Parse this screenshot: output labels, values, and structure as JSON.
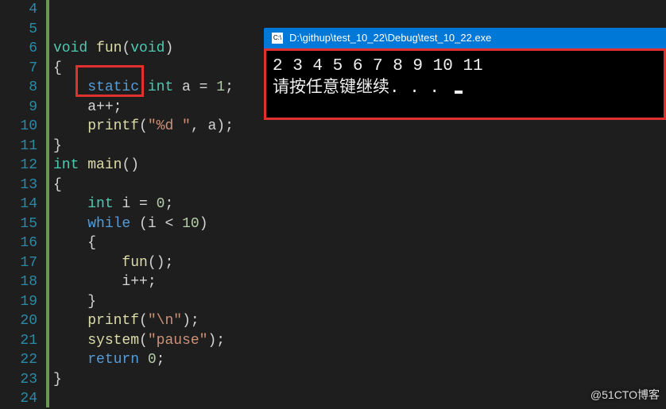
{
  "editor": {
    "lines": [
      {
        "n": 4,
        "tokens": []
      },
      {
        "n": 5,
        "tokens": []
      },
      {
        "n": 6,
        "collapse": true,
        "tokens": [
          {
            "t": "void",
            "c": "tok-type"
          },
          {
            "t": " ",
            "c": ""
          },
          {
            "t": "fun",
            "c": "tok-func"
          },
          {
            "t": "(",
            "c": "tok-punct"
          },
          {
            "t": "void",
            "c": "tok-type"
          },
          {
            "t": ")",
            "c": "tok-punct"
          }
        ]
      },
      {
        "n": 7,
        "tokens": [
          {
            "t": "{",
            "c": "tok-brace"
          }
        ]
      },
      {
        "n": 8,
        "tokens": [
          {
            "t": "    ",
            "c": ""
          },
          {
            "t": "static",
            "c": "tok-keyword"
          },
          {
            "t": " ",
            "c": ""
          },
          {
            "t": "int",
            "c": "tok-type"
          },
          {
            "t": " a ",
            "c": "tok-var"
          },
          {
            "t": "=",
            "c": "tok-op"
          },
          {
            "t": " ",
            "c": ""
          },
          {
            "t": "1",
            "c": "tok-number"
          },
          {
            "t": ";",
            "c": "tok-punct"
          }
        ]
      },
      {
        "n": 9,
        "tokens": [
          {
            "t": "    a",
            "c": "tok-var"
          },
          {
            "t": "++",
            "c": "tok-op"
          },
          {
            "t": ";",
            "c": "tok-punct"
          }
        ]
      },
      {
        "n": 10,
        "tokens": [
          {
            "t": "    ",
            "c": ""
          },
          {
            "t": "printf",
            "c": "tok-func"
          },
          {
            "t": "(",
            "c": "tok-punct"
          },
          {
            "t": "\"%d \"",
            "c": "tok-string"
          },
          {
            "t": ", a",
            "c": "tok-var"
          },
          {
            "t": ")",
            "c": "tok-punct"
          },
          {
            "t": ";",
            "c": "tok-punct"
          }
        ]
      },
      {
        "n": 11,
        "tokens": [
          {
            "t": "}",
            "c": "tok-brace"
          }
        ]
      },
      {
        "n": 12,
        "collapse": true,
        "tokens": [
          {
            "t": "int",
            "c": "tok-type"
          },
          {
            "t": " ",
            "c": ""
          },
          {
            "t": "main",
            "c": "tok-func"
          },
          {
            "t": "()",
            "c": "tok-punct"
          }
        ]
      },
      {
        "n": 13,
        "tokens": [
          {
            "t": "{",
            "c": "tok-brace"
          }
        ]
      },
      {
        "n": 14,
        "tokens": [
          {
            "t": "    ",
            "c": ""
          },
          {
            "t": "int",
            "c": "tok-type"
          },
          {
            "t": " i ",
            "c": "tok-var"
          },
          {
            "t": "=",
            "c": "tok-op"
          },
          {
            "t": " ",
            "c": ""
          },
          {
            "t": "0",
            "c": "tok-number"
          },
          {
            "t": ";",
            "c": "tok-punct"
          }
        ]
      },
      {
        "n": 15,
        "tokens": [
          {
            "t": "    ",
            "c": ""
          },
          {
            "t": "while",
            "c": "tok-keyword"
          },
          {
            "t": " (i ",
            "c": "tok-var"
          },
          {
            "t": "<",
            "c": "tok-op"
          },
          {
            "t": " ",
            "c": ""
          },
          {
            "t": "10",
            "c": "tok-number"
          },
          {
            "t": ")",
            "c": "tok-punct"
          }
        ]
      },
      {
        "n": 16,
        "tokens": [
          {
            "t": "    {",
            "c": "tok-brace"
          }
        ]
      },
      {
        "n": 17,
        "tokens": [
          {
            "t": "        ",
            "c": ""
          },
          {
            "t": "fun",
            "c": "tok-func"
          },
          {
            "t": "()",
            "c": "tok-punct"
          },
          {
            "t": ";",
            "c": "tok-punct"
          }
        ]
      },
      {
        "n": 18,
        "tokens": [
          {
            "t": "        i",
            "c": "tok-var"
          },
          {
            "t": "++",
            "c": "tok-op"
          },
          {
            "t": ";",
            "c": "tok-punct"
          }
        ]
      },
      {
        "n": 19,
        "tokens": [
          {
            "t": "    }",
            "c": "tok-brace"
          }
        ]
      },
      {
        "n": 20,
        "tokens": [
          {
            "t": "    ",
            "c": ""
          },
          {
            "t": "printf",
            "c": "tok-func"
          },
          {
            "t": "(",
            "c": "tok-punct"
          },
          {
            "t": "\"\\n\"",
            "c": "tok-string"
          },
          {
            "t": ")",
            "c": "tok-punct"
          },
          {
            "t": ";",
            "c": "tok-punct"
          }
        ]
      },
      {
        "n": 21,
        "tokens": [
          {
            "t": "    ",
            "c": ""
          },
          {
            "t": "system",
            "c": "tok-func"
          },
          {
            "t": "(",
            "c": "tok-punct"
          },
          {
            "t": "\"pause\"",
            "c": "tok-string"
          },
          {
            "t": ")",
            "c": "tok-punct"
          },
          {
            "t": ";",
            "c": "tok-punct"
          }
        ]
      },
      {
        "n": 22,
        "tokens": [
          {
            "t": "    ",
            "c": ""
          },
          {
            "t": "return",
            "c": "tok-keyword"
          },
          {
            "t": " ",
            "c": ""
          },
          {
            "t": "0",
            "c": "tok-number"
          },
          {
            "t": ";",
            "c": "tok-punct"
          }
        ]
      },
      {
        "n": 23,
        "tokens": [
          {
            "t": "}",
            "c": "tok-brace"
          }
        ]
      },
      {
        "n": 24,
        "tokens": []
      }
    ]
  },
  "console": {
    "title": "D:\\githup\\test_10_22\\Debug\\test_10_22.exe",
    "line1": "2 3 4 5 6 7 8 9 10 11",
    "line2": "请按任意键继续. . . "
  },
  "watermark": "@51CTO博客",
  "icons": {
    "cmd": "C:\\"
  }
}
